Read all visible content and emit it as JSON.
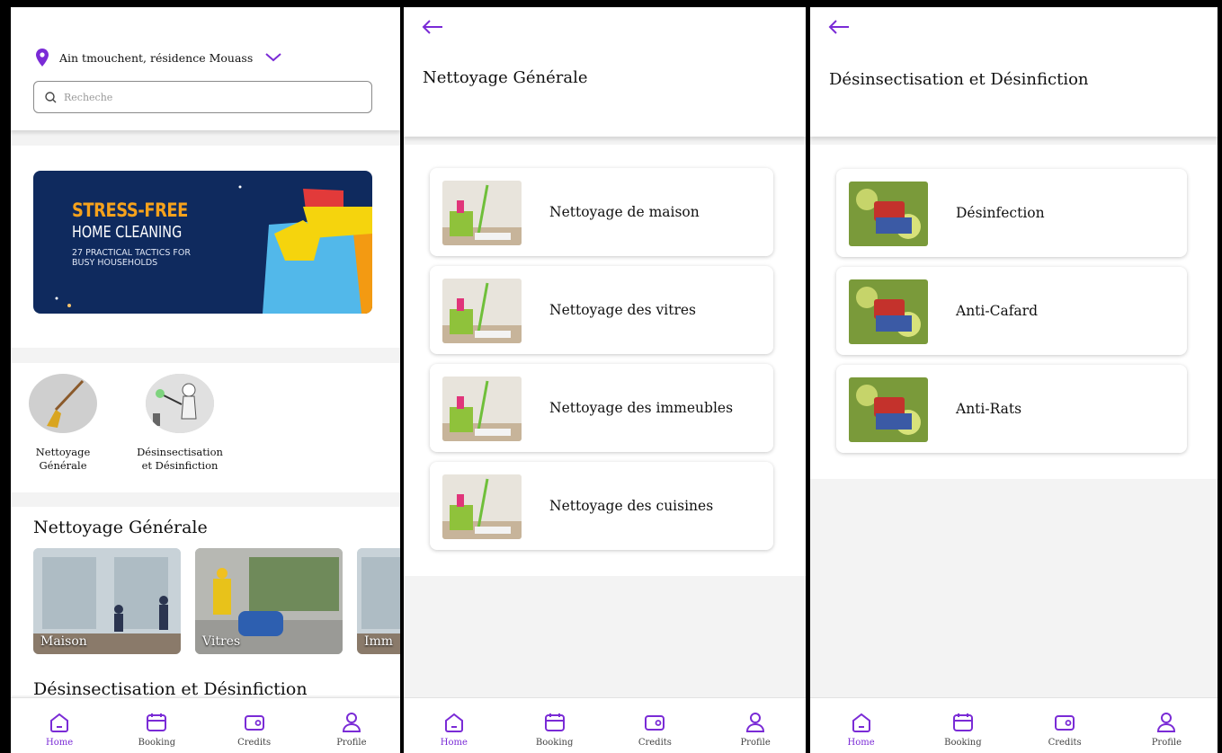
{
  "screens": {
    "home": {
      "location": "Ain tmouchent, résidence Mouass",
      "search_placeholder": "Recheche",
      "banner": {
        "line1": "STRESS-FREE",
        "line2": "HOME CLEANING",
        "line3": "27 PRACTICAL TACTICS FOR BUSY HOUSEHOLDS"
      },
      "categories": [
        {
          "label": "Nettoyage Générale",
          "icon": "broom-icon"
        },
        {
          "label": "Désinsectisation et Désinfiction",
          "icon": "sprayer-icon"
        }
      ],
      "section_title": "Nettoyage Générale",
      "tiles": [
        "Maison",
        "Vitres",
        "Imm"
      ],
      "section2_title": "Désinsectisation et Désinfiction"
    },
    "nettoyage": {
      "title": "Nettoyage Générale",
      "items": [
        "Nettoyage de maison",
        "Nettoyage des vitres",
        "Nettoyage des immeubles",
        "Nettoyage des cuisines"
      ]
    },
    "desinsectisation": {
      "title": "Désinsectisation et Désinfiction",
      "items": [
        "Désinfection",
        "Anti-Cafard",
        "Anti-Rats"
      ]
    }
  },
  "nav": {
    "items": [
      {
        "label": "Home",
        "icon": "home-icon",
        "active": true
      },
      {
        "label": "Booking",
        "icon": "calendar-icon",
        "active": false
      },
      {
        "label": "Credits",
        "icon": "wallet-icon",
        "active": false
      },
      {
        "label": "Profile",
        "icon": "profile-icon",
        "active": false
      }
    ]
  },
  "colors": {
    "accent": "#7a2bd6",
    "banner_bg": "#0f2a5e",
    "banner_highlight": "#f6a21c"
  }
}
